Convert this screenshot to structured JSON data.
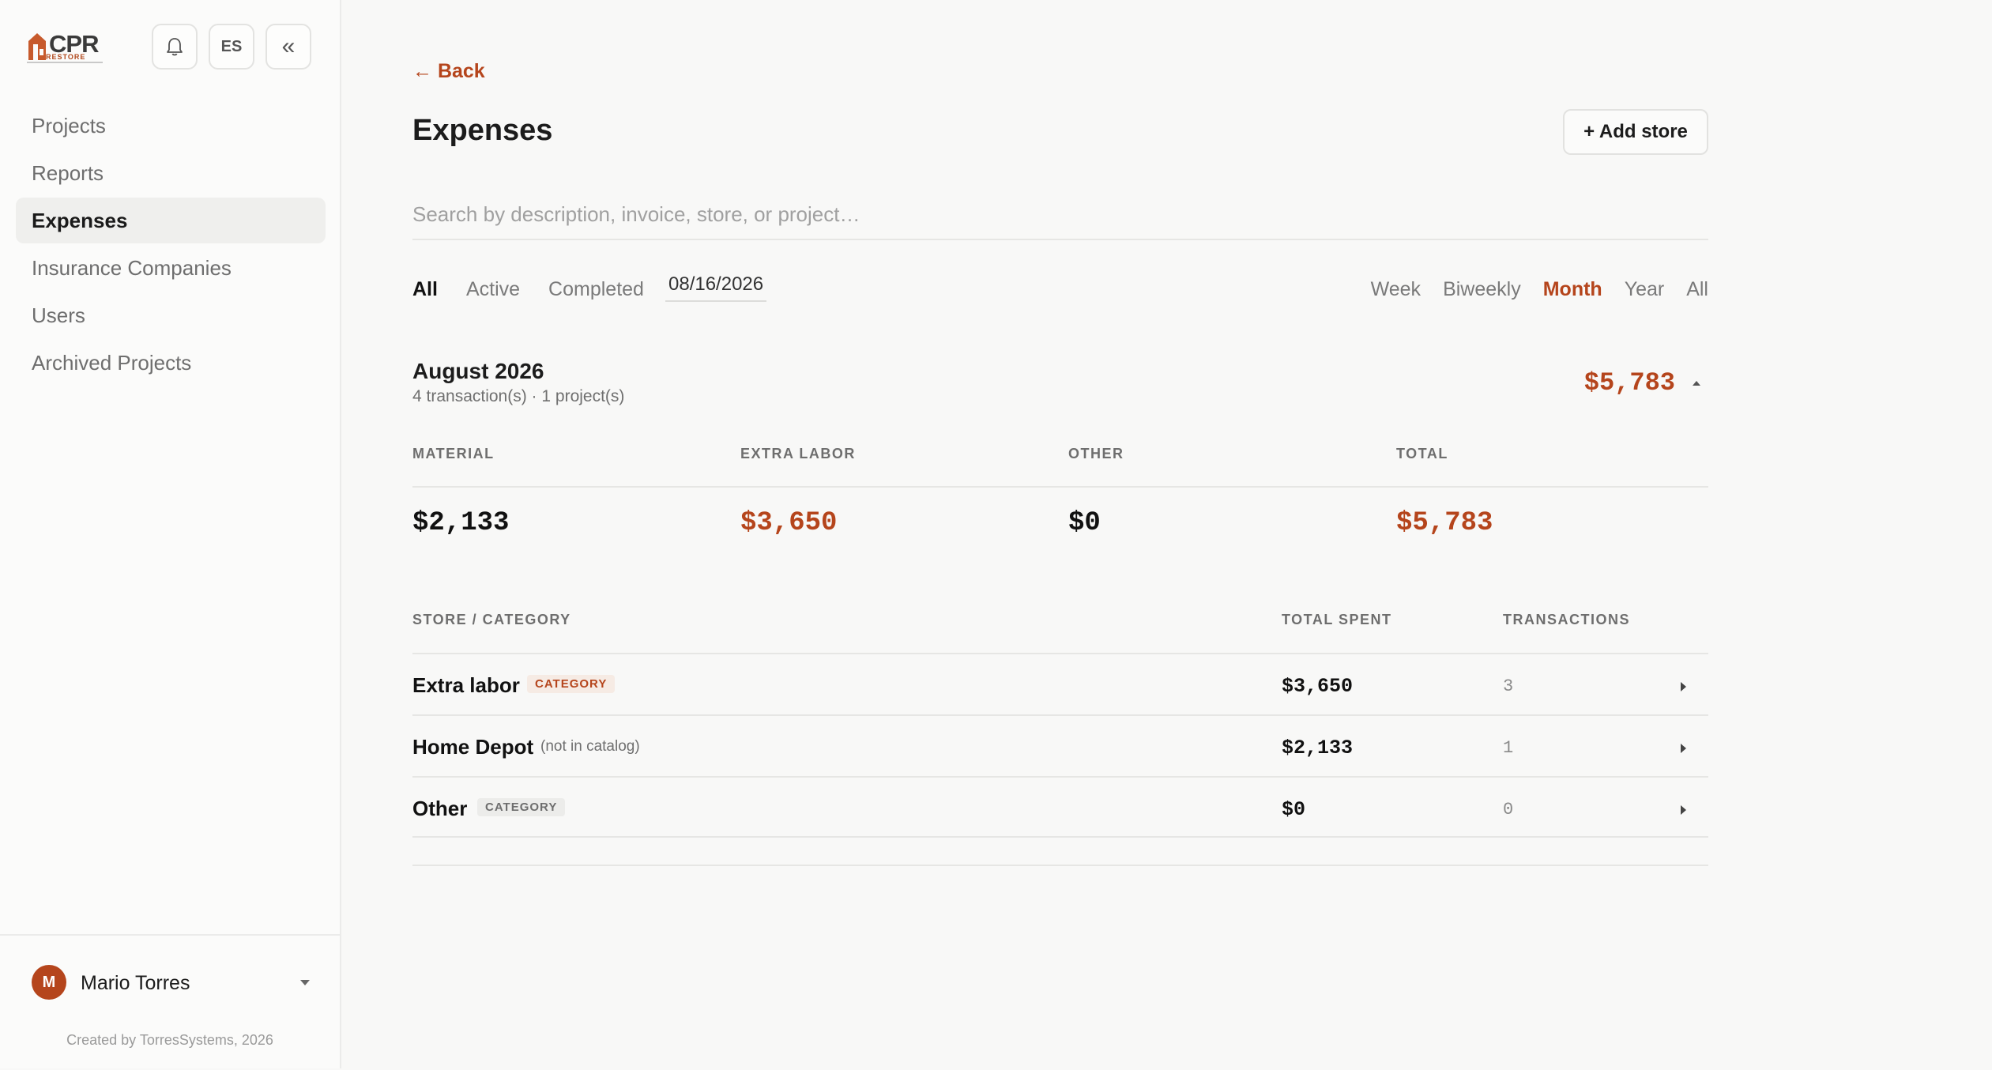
{
  "brand": {
    "logo_text": "CPR",
    "logo_sub": "RESTORE"
  },
  "topbar": {
    "lang_label": "ES",
    "collapse_label": "«"
  },
  "sidebar": {
    "items": [
      {
        "label": "Projects",
        "active": false
      },
      {
        "label": "Reports",
        "active": false
      },
      {
        "label": "Expenses",
        "active": true
      },
      {
        "label": "Insurance Companies",
        "active": false
      },
      {
        "label": "Users",
        "active": false
      },
      {
        "label": "Archived Projects",
        "active": false
      }
    ]
  },
  "user": {
    "initial": "M",
    "name": "Mario Torres"
  },
  "footer": {
    "credit": "Created by TorresSystems, 2026"
  },
  "page": {
    "back_label": "← Back",
    "title": "Expenses",
    "add_store_label": "+ Add store",
    "search_placeholder": "Search by description, invoice, store, or project…"
  },
  "filters": {
    "status_tabs": [
      "All",
      "Active",
      "Completed"
    ],
    "status_active": "All",
    "date": "08/16/2026",
    "period_tabs": [
      "Week",
      "Biweekly",
      "Month",
      "Year",
      "All"
    ],
    "period_active": "Month"
  },
  "period": {
    "title": "August 2026",
    "subtitle": "4 transaction(s) · 1 project(s)",
    "total": "$5,783"
  },
  "summary": {
    "material_label": "MATERIAL",
    "material_value": "$2,133",
    "extra_labor_label": "EXTRA LABOR",
    "extra_labor_value": "$3,650",
    "other_label": "OTHER",
    "other_value": "$0",
    "total_label": "TOTAL",
    "total_value": "$5,783"
  },
  "table": {
    "headers": {
      "store": "STORE / CATEGORY",
      "spent": "TOTAL SPENT",
      "transactions": "TRANSACTIONS"
    },
    "rows": [
      {
        "name": "Extra labor",
        "tag": "CATEGORY",
        "note": "",
        "spent": "$3,650",
        "transactions": "3"
      },
      {
        "name": "Home Depot",
        "tag": "",
        "note": "(not in catalog)",
        "spent": "$2,133",
        "transactions": "1"
      },
      {
        "name": "Other",
        "tag": "CATEGORY",
        "note": "",
        "spent": "$0",
        "transactions": "0"
      }
    ]
  },
  "colors": {
    "accent": "#b5451c",
    "background": "#f8f8f7",
    "sidebar": "#fbfbfa"
  }
}
